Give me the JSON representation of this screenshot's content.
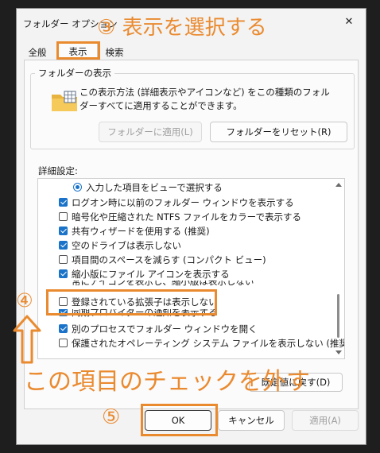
{
  "window": {
    "title": "フォルダー オプション",
    "close_glyph": "✕"
  },
  "tabs": [
    {
      "label": "全般",
      "active": false
    },
    {
      "label": "表示",
      "active": true
    },
    {
      "label": "検索",
      "active": false
    }
  ],
  "folder_view": {
    "group_label": "フォルダーの表示",
    "description": "この表示方法 (詳細表示やアイコンなど) をこの種類のフォルダーすべてに適用することができます。",
    "apply_button": "フォルダーに適用(L)",
    "reset_button": "フォルダーをリセット(R)"
  },
  "advanced": {
    "label": "詳細設定:",
    "items": [
      {
        "type": "radio",
        "checked": true,
        "label": "入力した項目をビューで選択する"
      },
      {
        "type": "checkbox",
        "checked": true,
        "label": "ログオン時に以前のフォルダー ウィンドウを表示する"
      },
      {
        "type": "checkbox",
        "checked": false,
        "label": "暗号化や圧縮された NTFS ファイルをカラーで表示する"
      },
      {
        "type": "checkbox",
        "checked": true,
        "label": "共有ウィザードを使用する (推奨)"
      },
      {
        "type": "checkbox",
        "checked": true,
        "label": "空のドライブは表示しない"
      },
      {
        "type": "checkbox",
        "checked": false,
        "label": "項目間のスペースを減らす (コンパクト ビュー)"
      },
      {
        "type": "checkbox",
        "checked": true,
        "label": "縮小版にファイル アイコンを表示する"
      },
      {
        "type": "checkbox",
        "checked": false,
        "label": "常にアイコンを表示し、縮小版は表示しない"
      },
      {
        "type": "checkbox",
        "checked": false,
        "label": "登録されている拡張子は表示しない"
      },
      {
        "type": "checkbox",
        "checked": true,
        "label": "同期プロバイダーの通知を表示する"
      },
      {
        "type": "checkbox",
        "checked": false,
        "label": "別のプロセスでフォルダー ウィンドウを開く"
      },
      {
        "type": "checkbox",
        "checked": false,
        "label": "保護されたオペレーティング システム ファイルを表示しない (推奨)"
      }
    ],
    "restore_button": "既定値に戻す(D)"
  },
  "buttons": {
    "ok": "OK",
    "cancel": "キャンセル",
    "apply": "適用(A)"
  },
  "annotations": {
    "step3": "③ 表示を選択する",
    "step4": "④",
    "step5": "⑤",
    "instruction": "この項目のチェックを外す"
  },
  "colors": {
    "annotation": "#ea8a2f",
    "checkbox_accent": "#1a73c8"
  }
}
